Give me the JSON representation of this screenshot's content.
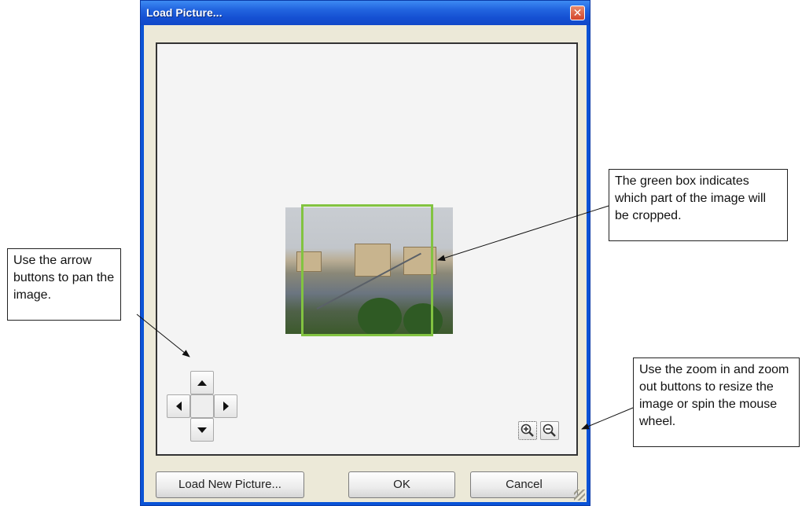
{
  "dialog": {
    "title": "Load Picture...",
    "close_symbol": "✕",
    "buttons": {
      "load_new": "Load New Picture...",
      "ok": "OK",
      "cancel": "Cancel"
    }
  },
  "callouts": {
    "pan": "Use the arrow buttons to pan the image.",
    "crop": "The green box indicates which part of the image will be cropped.",
    "zoom": "Use the zoom in and zoom out buttons to resize the image or spin the mouse wheel."
  },
  "colors": {
    "titlebar": "#1550d2",
    "crop_box": "#82c341",
    "dialog_face": "#ece9d8"
  },
  "icons": [
    "close-icon",
    "arrow-up-icon",
    "arrow-down-icon",
    "arrow-left-icon",
    "arrow-right-icon",
    "zoom-in-icon",
    "zoom-out-icon"
  ]
}
